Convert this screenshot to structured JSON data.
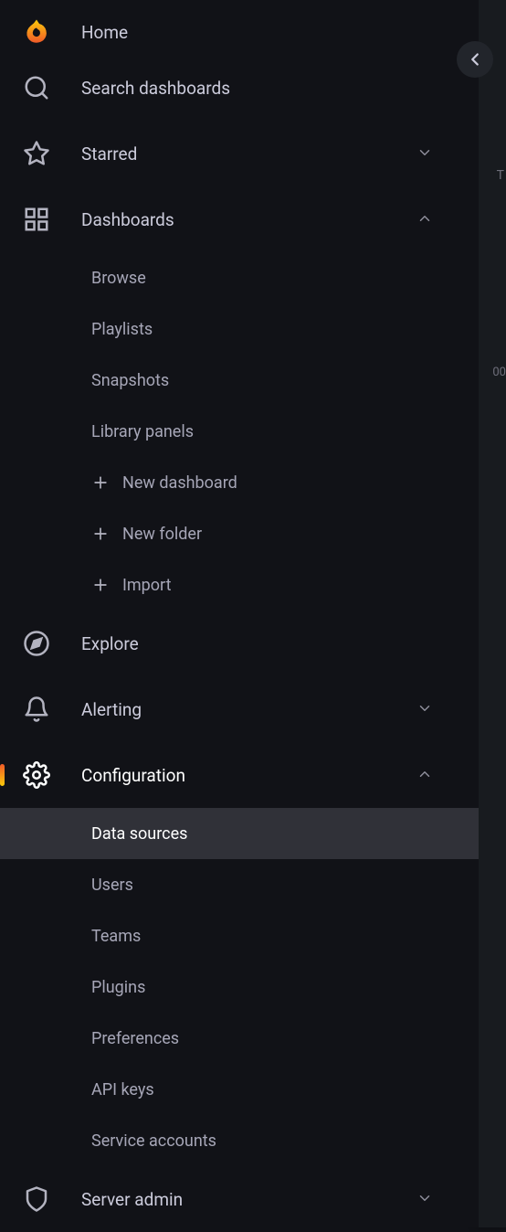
{
  "nav": {
    "home": {
      "label": "Home"
    },
    "search": {
      "label": "Search dashboards"
    },
    "starred": {
      "label": "Starred"
    },
    "dashboards": {
      "label": "Dashboards",
      "items": [
        {
          "label": "Browse"
        },
        {
          "label": "Playlists"
        },
        {
          "label": "Snapshots"
        },
        {
          "label": "Library panels"
        }
      ],
      "actions": [
        {
          "label": "New dashboard"
        },
        {
          "label": "New folder"
        },
        {
          "label": "Import"
        }
      ]
    },
    "explore": {
      "label": "Explore"
    },
    "alerting": {
      "label": "Alerting"
    },
    "configuration": {
      "label": "Configuration",
      "items": [
        {
          "label": "Data sources"
        },
        {
          "label": "Users"
        },
        {
          "label": "Teams"
        },
        {
          "label": "Plugins"
        },
        {
          "label": "Preferences"
        },
        {
          "label": "API keys"
        },
        {
          "label": "Service accounts"
        }
      ]
    },
    "serverAdmin": {
      "label": "Server admin"
    }
  },
  "peek": {
    "t": "T",
    "val": "00"
  }
}
